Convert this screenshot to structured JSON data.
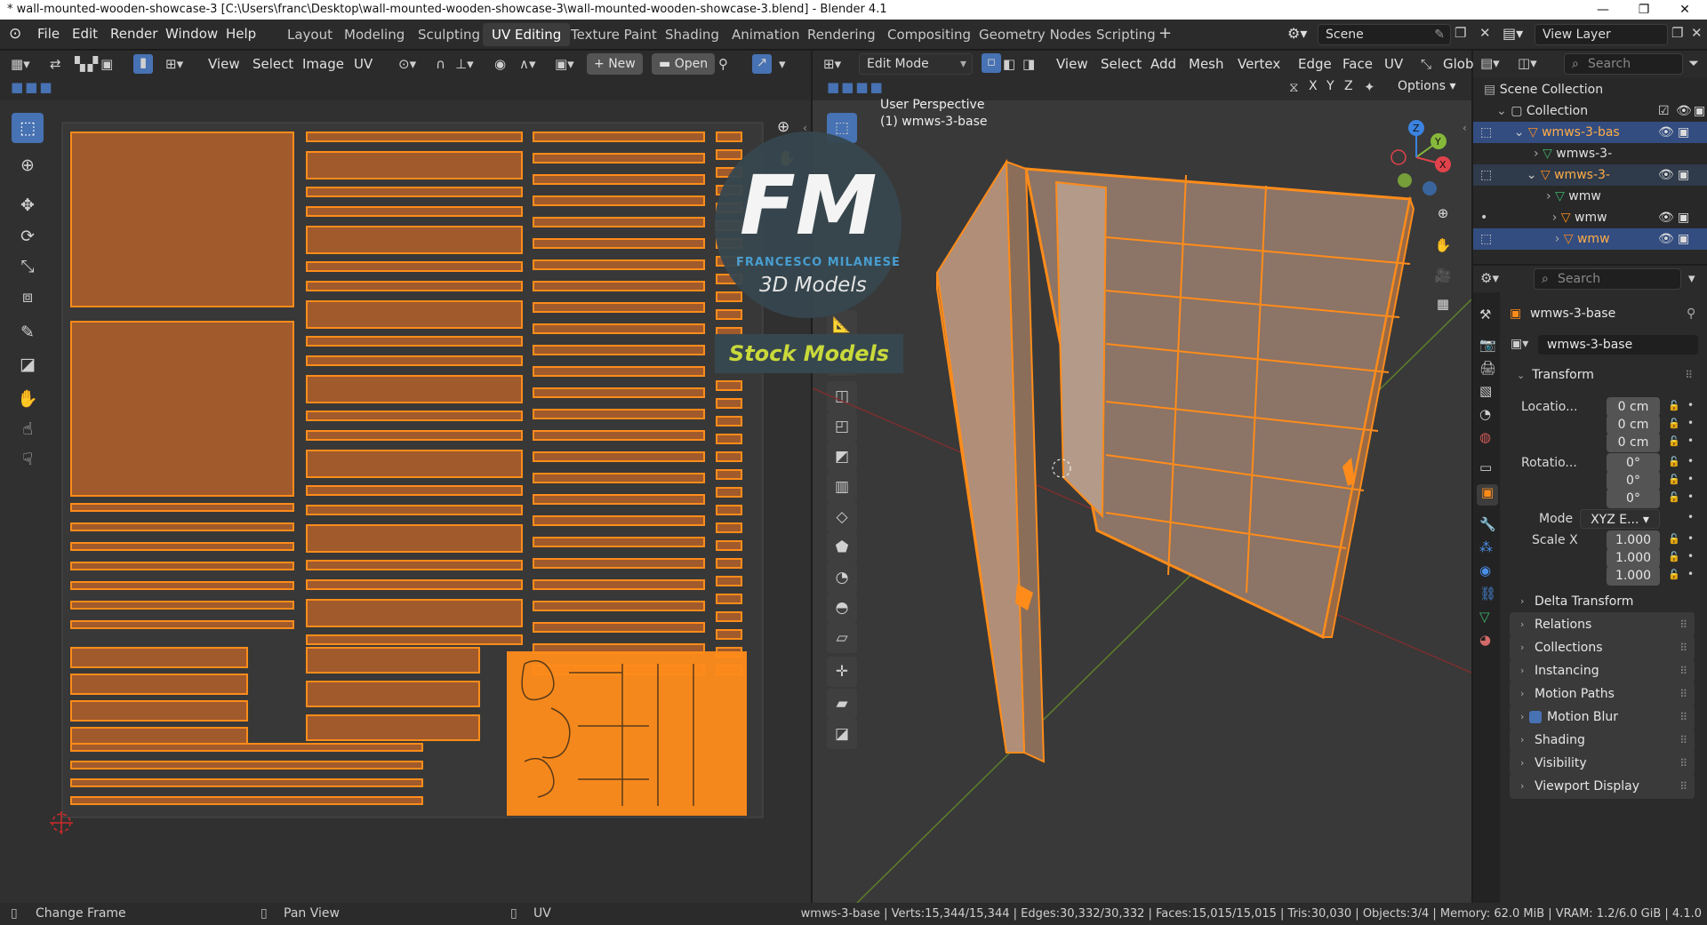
{
  "window": {
    "title": "* wall-mounted-wooden-showcase-3 [C:\\Users\\franc\\Desktop\\wall-mounted-wooden-showcase-3\\wall-mounted-wooden-showcase-3.blend] - Blender 4.1"
  },
  "menu": [
    "File",
    "Edit",
    "Render",
    "Window",
    "Help"
  ],
  "workspaces": [
    "Layout",
    "Modeling",
    "Sculpting",
    "UV Editing",
    "Texture Paint",
    "Shading",
    "Animation",
    "Rendering",
    "Compositing",
    "Geometry Nodes",
    "Scripting"
  ],
  "active_workspace": "UV Editing",
  "scene": {
    "name": "Scene",
    "view_layer": "View Layer"
  },
  "uv_editor": {
    "menus": [
      "View",
      "Select",
      "Image",
      "UV"
    ],
    "new_label": "New",
    "open_label": "Open"
  },
  "viewport": {
    "mode": "Edit Mode",
    "menus": [
      "View",
      "Select",
      "Add",
      "Mesh",
      "Vertex",
      "Edge",
      "Face",
      "UV"
    ],
    "orientation": "Glob",
    "axes": [
      "X",
      "Y",
      "Z"
    ],
    "options_label": "Options",
    "view_name": "User Perspective",
    "object_label": "(1) wmws-3-base",
    "watermark": {
      "monogram": "FM",
      "name": "FRANCESCO MILANESE",
      "sub": "3D Models",
      "banner": "Stock Models"
    }
  },
  "outliner": {
    "search_placeholder": "Search",
    "root": "Scene Collection",
    "collection": "Collection",
    "items": [
      {
        "label": "wmws-3-bas",
        "type": "mesh",
        "selected": true
      },
      {
        "label": "wmws-3-",
        "type": "mesh-data"
      },
      {
        "label": "wmws-3-",
        "type": "mesh"
      },
      {
        "label": "wmw",
        "type": "mesh-data"
      },
      {
        "label": "wmw",
        "type": "mesh"
      },
      {
        "label": "wmw",
        "type": "mesh",
        "selected": true
      }
    ]
  },
  "properties": {
    "search_placeholder": "Search",
    "object_name": "wmws-3-base",
    "datablock_name": "wmws-3-base",
    "transform_label": "Transform",
    "location_label": "Locatio...",
    "location": [
      "0 cm",
      "0 cm",
      "0 cm"
    ],
    "rotation_label": "Rotatio...",
    "rotation": [
      "0°",
      "0°",
      "0°"
    ],
    "mode_label": "Mode",
    "mode_value": "XYZ E...",
    "scale_label": "Scale X",
    "scale": [
      "1.000",
      "1.000",
      "1.000"
    ],
    "axis_y": "Y",
    "axis_z": "Z",
    "sections": [
      "Delta Transform",
      "Relations",
      "Collections",
      "Instancing",
      "Motion Paths",
      "Motion Blur",
      "Shading",
      "Visibility",
      "Viewport Display"
    ]
  },
  "status": {
    "left1": "Change Frame",
    "left2": "Pan View",
    "left3": "UV",
    "stats": "wmws-3-base | Verts:15,344/15,344 | Edges:30,332/30,332 | Faces:15,015/15,015 | Tris:30,030 | Objects:3/4 | Memory: 62.0 MiB | VRAM: 1.2/6.0 GiB | 4.1.0"
  },
  "colors": {
    "accent": "#4772b3",
    "uv_island": "#a05a2c",
    "selection": "#ff8c1a"
  }
}
